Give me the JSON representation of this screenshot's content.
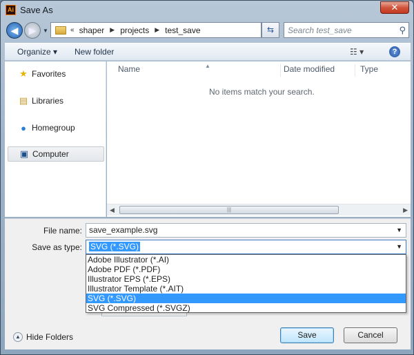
{
  "window": {
    "title": "Save As",
    "app_icon_text": "Ai",
    "close_glyph": "✕"
  },
  "nav": {
    "back_glyph": "◀",
    "forward_glyph": "▶",
    "breadcrumb_prefix": "«",
    "breadcrumbs": [
      "shaper",
      "projects",
      "test_save"
    ],
    "search_placeholder": "Search test_save"
  },
  "toolbar": {
    "organize_label": "Organize ▾",
    "new_folder_label": "New folder",
    "view_label": "☷ ▾",
    "help_label": "?"
  },
  "sidebar": {
    "items": [
      {
        "label": "Favorites",
        "icon": "star-icon"
      },
      {
        "label": "Libraries",
        "icon": "library-icon"
      },
      {
        "label": "Homegroup",
        "icon": "homegroup-icon"
      },
      {
        "label": "Computer",
        "icon": "computer-icon"
      }
    ]
  },
  "file_list": {
    "columns": [
      "Name",
      "Date modified",
      "Type"
    ],
    "empty_message": "No items match your search."
  },
  "form": {
    "file_name_label": "File name:",
    "file_name_value": "save_example.svg",
    "save_type_label": "Save as type:",
    "save_type_value": "SVG (*.SVG)",
    "type_options": [
      "Adobe Illustrator (*.AI)",
      "Adobe PDF (*.PDF)",
      "Illustrator EPS (*.EPS)",
      "Illustrator Template (*.AIT)",
      "SVG (*.SVG)",
      "SVG Compressed (*.SVGZ)"
    ],
    "selected_option_index": 4
  },
  "footer": {
    "hide_folders_label": "Hide Folders",
    "save_label": "Save",
    "cancel_label": "Cancel"
  }
}
